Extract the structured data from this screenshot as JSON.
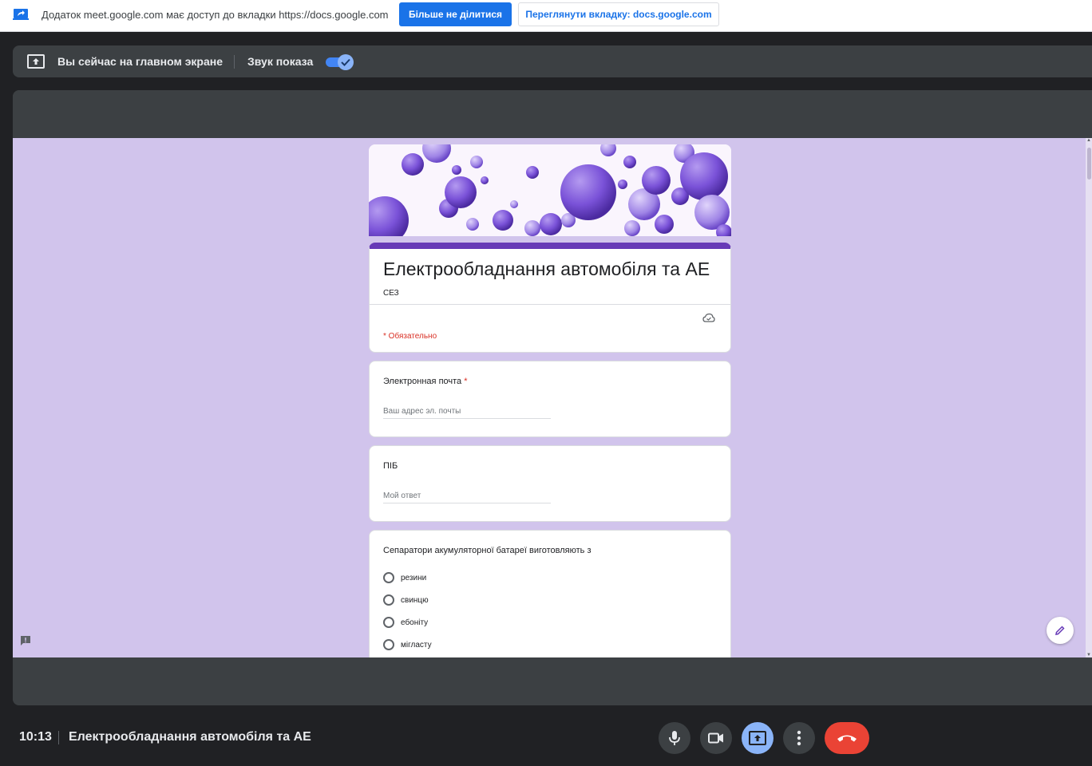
{
  "share_bar": {
    "message": "Додаток meet.google.com має доступ до вкладки https://docs.google.com",
    "stop_label": "Більше не ділитися",
    "view_label": "Переглянути вкладку: docs.google.com"
  },
  "presenting": {
    "label": "Вы сейчас на главном экране",
    "audio_label": "Звук показа",
    "audio_enabled": true
  },
  "form": {
    "title": "Електрообладнання автомобіля та АЕ",
    "description": "СЕЗ",
    "required_note": "* Обязательно",
    "email": {
      "label": "Электронная почта",
      "required_mark": "*",
      "placeholder": "Ваш адрес эл. почты"
    },
    "name_question": {
      "label": "ПІБ",
      "placeholder": "Мой ответ"
    },
    "question": {
      "label": "Сепаратори акумуляторної батареї виготовляють з",
      "options": [
        "резини",
        "свинцю",
        "ебоніту",
        "мігласту"
      ]
    },
    "accent_color": "#673ab7",
    "background_color": "#d1c4ec"
  },
  "bottom_bar": {
    "time": "10:13",
    "meeting_title": "Електрообладнання автомобіля та АЕ"
  },
  "icons": {
    "share": "screen-share-icon",
    "present": "present-to-all-icon",
    "cloud": "cloud-save-icon",
    "feedback": "feedback-icon",
    "edit": "pencil-icon",
    "mic": "mic-icon",
    "camera": "videocam-icon",
    "present_ctrl": "present-to-all-icon",
    "more": "more-vert-icon",
    "end_call": "call-end-icon"
  }
}
